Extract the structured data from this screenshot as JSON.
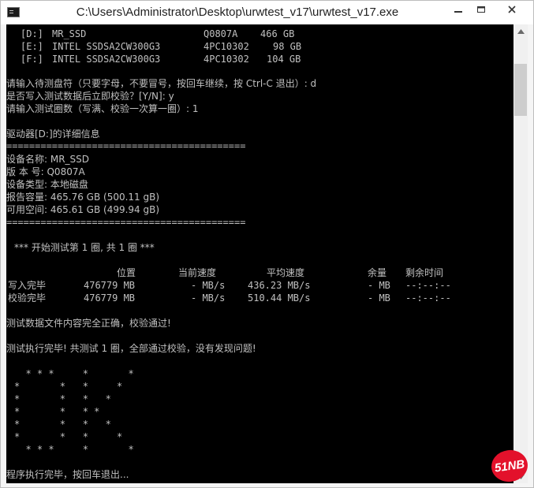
{
  "window": {
    "title": "C:\\Users\\Administrator\\Desktop\\urwtest_v17\\urwtest_v17.exe"
  },
  "console": {
    "drives": [
      {
        "letter": "[D:]",
        "model": "MR_SSD",
        "serial": "Q0807A",
        "size": "466 GB"
      },
      {
        "letter": "[E:]",
        "model": "INTEL SSDSA2CW300G3",
        "serial": "4PC10302",
        "size": "98 GB"
      },
      {
        "letter": "[F:]",
        "model": "INTEL SSDSA2CW300G3",
        "serial": "4PC10302",
        "size": "104 GB"
      }
    ],
    "prompt_drive": "请输入待测盘符（只要字母，不要冒号，按回车继续，按 Ctrl-C 退出）: d",
    "prompt_verify": "是否写入测试数据后立即校验？[Y/N]: y",
    "prompt_rounds": "请输入测试圈数（写满、校验一次算一圈）: 1",
    "drive_detail_title": "驱动器[D:]的详细信息",
    "separator": "==========================================",
    "device_name": "设备名称: MR_SSD",
    "version": "版 本 号: Q0807A",
    "device_type": "设备类型: 本地磁盘",
    "reported_capacity": "报告容量: 465.76 GB (500.11 gB)",
    "free_space": "可用空间: 465.61 GB (499.94 gB)",
    "start_test": "*** 开始测试第 1 圈, 共 1 圈 ***",
    "table_header": {
      "position": "位置",
      "current_speed": "当前速度",
      "avg_speed": "平均速度",
      "remaining": "余量",
      "time_left": "剩余时间"
    },
    "rows": [
      {
        "label": "写入完毕",
        "position": "476779 MB",
        "current": "- MB/s",
        "avg": "436.23 MB/s",
        "remaining": "- MB",
        "time": "--:--:--"
      },
      {
        "label": "校验完毕",
        "position": "476779 MB",
        "current": "- MB/s",
        "avg": "510.44 MB/s",
        "remaining": "- MB",
        "time": "--:--:--"
      }
    ],
    "verify_ok": "测试数据文件内容完全正确，校验通过!",
    "test_done": "测试执行完毕! 共测试 1 圈，全部通过校验，没有发现问题!",
    "ok_art": [
      "  * * *     *       *",
      "*       *   *     *",
      "*       *   *   *",
      "*       *   * *",
      "*       *   *   *",
      "*       *   *     *",
      "  * * *     *       *"
    ],
    "exit_prompt": "程序执行完毕，按回车退出..."
  },
  "watermark": {
    "text": "51NB"
  }
}
